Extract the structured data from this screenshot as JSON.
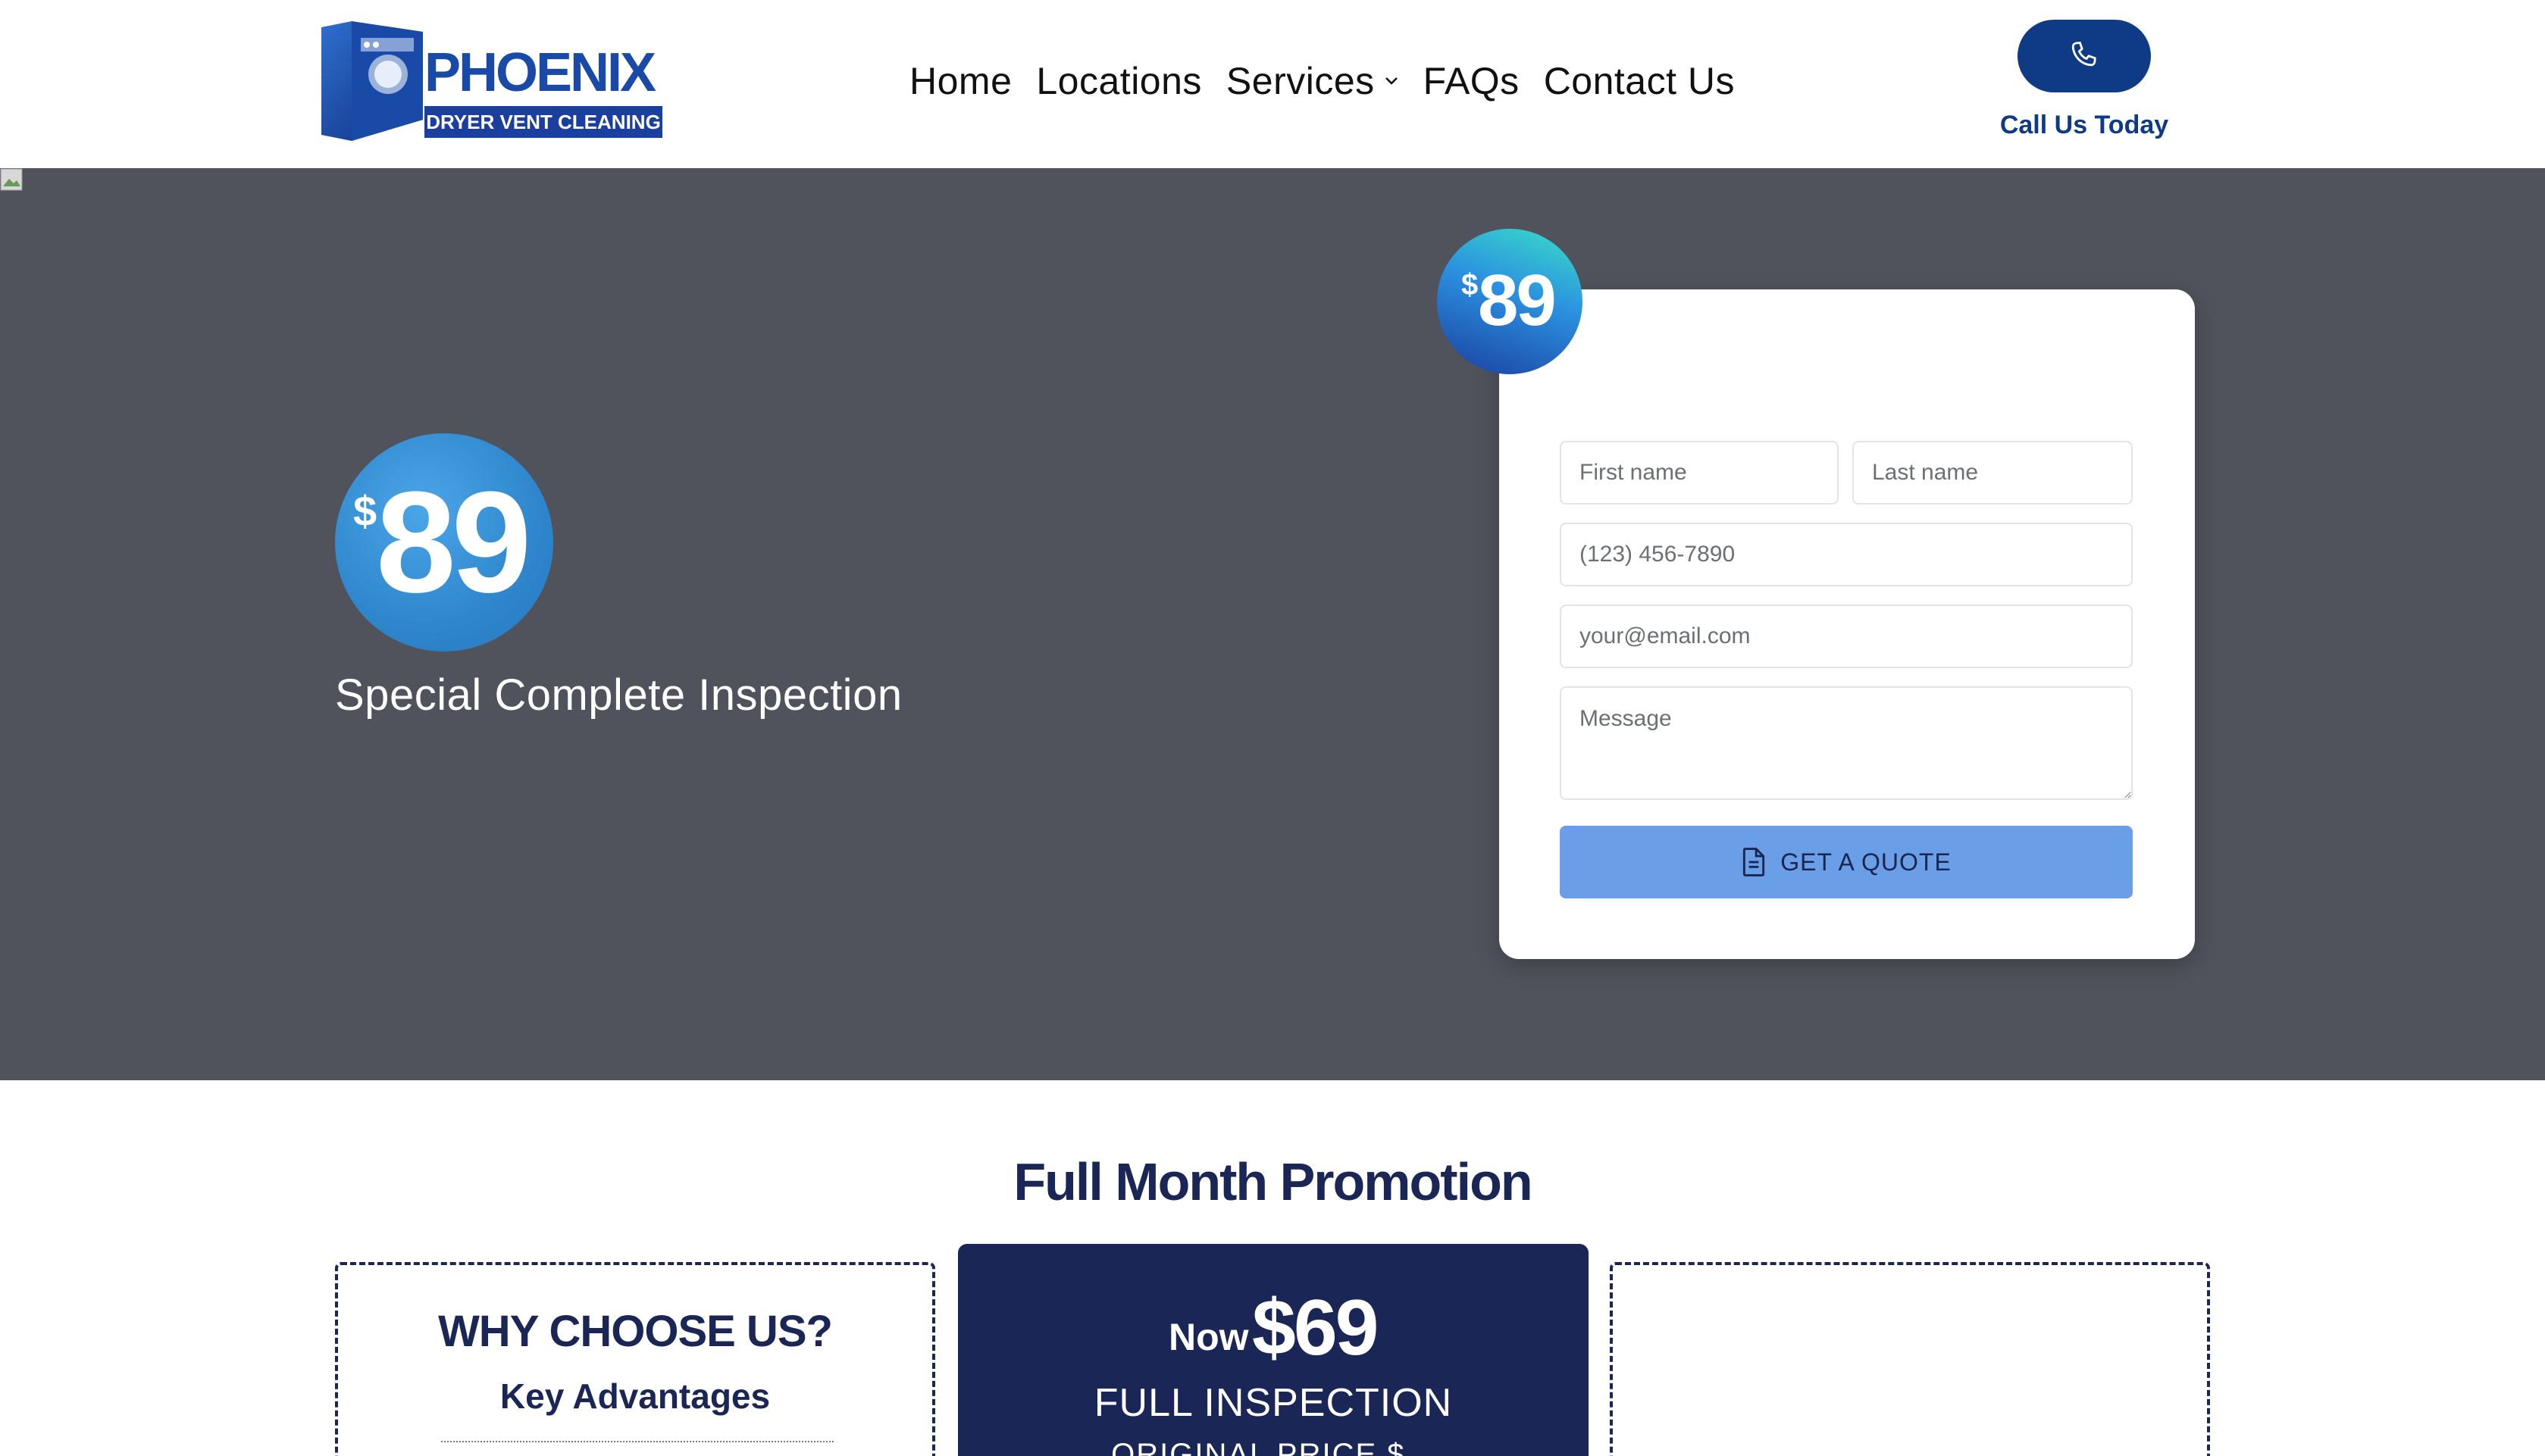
{
  "header": {
    "logo": {
      "brand": "PHOENIX",
      "tagline": "DRYER VENT CLEANING"
    },
    "nav": [
      {
        "label": "Home"
      },
      {
        "label": "Locations"
      },
      {
        "label": "Services",
        "has_dropdown": true
      },
      {
        "label": "FAQs"
      },
      {
        "label": "Contact Us"
      }
    ],
    "call": {
      "label": "Call Us Today",
      "icon": "phone-icon"
    }
  },
  "hero": {
    "badge": {
      "currency": "$",
      "amount": "89"
    },
    "subtitle": "Special Complete Inspection",
    "form": {
      "badge": {
        "currency": "$",
        "amount": "89"
      },
      "first_name_placeholder": "First name",
      "last_name_placeholder": "Last name",
      "phone_placeholder": "(123) 456-7890",
      "email_placeholder": "your@email.com",
      "message_placeholder": "Message",
      "submit_label": "GET A QUOTE"
    }
  },
  "promo": {
    "title": "Full Month Promotion",
    "why": {
      "heading": "WHY CHOOSE US?",
      "subheading": "Key Advantages"
    },
    "offer": {
      "now_label": "Now",
      "price": "$69",
      "headline": "FULL INSPECTION",
      "original_label": "ORIGINAL PRICE $..."
    }
  },
  "colors": {
    "brand_navy": "#1a2655",
    "brand_blue": "#0f3a85",
    "hero_bg": "#50535c",
    "button_blue": "#6a9ee6"
  }
}
